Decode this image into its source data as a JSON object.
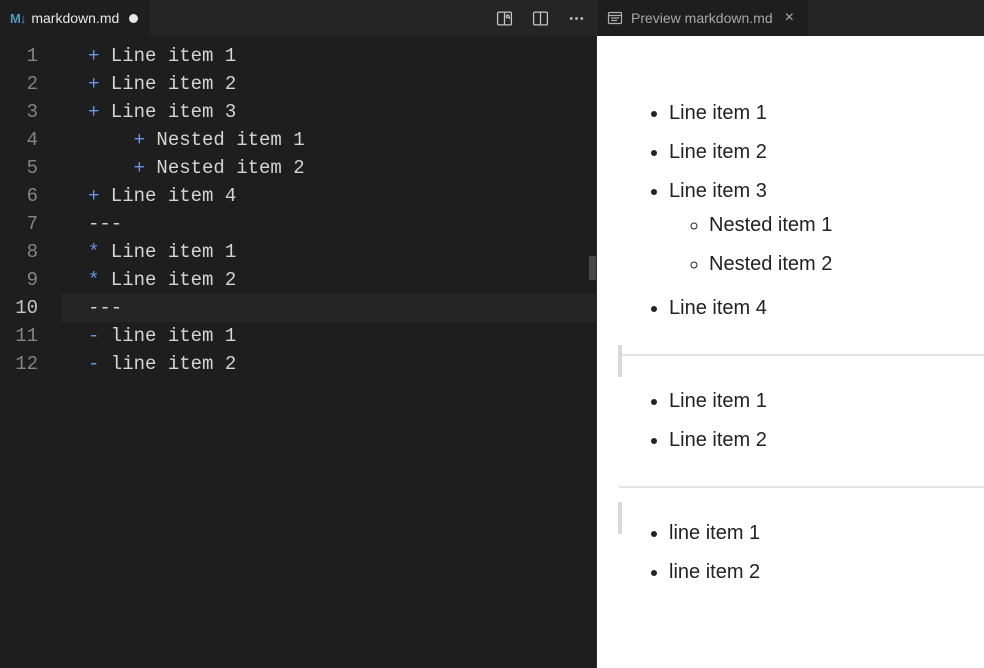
{
  "editor": {
    "tab": {
      "icon_text": "M↓",
      "filename": "markdown.md",
      "dirty": true
    },
    "actions": {
      "preview_side": "Open Preview to the Side",
      "split": "Split Editor",
      "more": "More Actions"
    },
    "active_line": 10,
    "lines": [
      {
        "num": 1,
        "indent": "",
        "bullet": "+",
        "text": "Line item 1"
      },
      {
        "num": 2,
        "indent": "",
        "bullet": "+",
        "text": "Line item 2"
      },
      {
        "num": 3,
        "indent": "",
        "bullet": "+",
        "text": "Line item 3"
      },
      {
        "num": 4,
        "indent": "    ",
        "bullet": "+",
        "text": "Nested item 1"
      },
      {
        "num": 5,
        "indent": "    ",
        "bullet": "+",
        "text": "Nested item 2"
      },
      {
        "num": 6,
        "indent": "",
        "bullet": "+",
        "text": "Line item 4"
      },
      {
        "num": 7,
        "indent": "",
        "bullet": "",
        "text": "---"
      },
      {
        "num": 8,
        "indent": "",
        "bullet": "*",
        "text": "Line item 1"
      },
      {
        "num": 9,
        "indent": "",
        "bullet": "*",
        "text": "Line item 2"
      },
      {
        "num": 10,
        "indent": "",
        "bullet": "",
        "text": "---"
      },
      {
        "num": 11,
        "indent": "",
        "bullet": "-",
        "text": "line item 1"
      },
      {
        "num": 12,
        "indent": "",
        "bullet": "-",
        "text": "line item 2"
      }
    ]
  },
  "preview": {
    "tab": {
      "label": "Preview markdown.md"
    },
    "groups": [
      {
        "items": [
          {
            "text": "Line item 1"
          },
          {
            "text": "Line item 2"
          },
          {
            "text": "Line item 3",
            "children": [
              {
                "text": "Nested item 1"
              },
              {
                "text": "Nested item 2"
              }
            ]
          },
          {
            "text": "Line item 4"
          }
        ]
      },
      {
        "items": [
          {
            "text": "Line item 1"
          },
          {
            "text": "Line item 2"
          }
        ]
      },
      {
        "items": [
          {
            "text": "line item 1"
          },
          {
            "text": "line item 2"
          }
        ]
      }
    ]
  }
}
